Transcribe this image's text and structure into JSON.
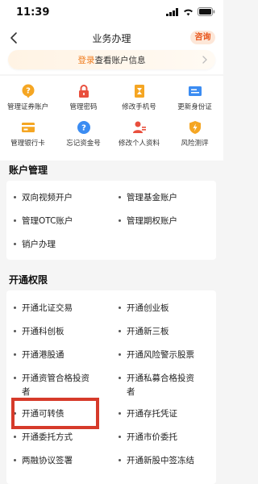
{
  "status_bar": {
    "time": "11:39",
    "signal_icon": "signal-icon",
    "wifi_icon": "wifi-icon",
    "battery_icon": "battery-icon"
  },
  "nav": {
    "title": "业务办理",
    "consult_label": "咨询",
    "back_icon": "chevron-left-icon"
  },
  "login_bar": {
    "link_text": "登录",
    "text": "查看账户信息",
    "arrow_icon": "chevron-right-icon"
  },
  "quick_grid": [
    {
      "label": "管理证券账户",
      "icon": "question-mark-icon",
      "color": "#f5a623"
    },
    {
      "label": "管理密码",
      "icon": "lock-icon",
      "color": "#e94f3d"
    },
    {
      "label": "修改手机号",
      "icon": "hourglass-icon",
      "color": "#f5a623"
    },
    {
      "label": "更新身份证",
      "icon": "id-card-icon",
      "color": "#3b8cf2"
    },
    {
      "label": "管理银行卡",
      "icon": "bank-card-icon",
      "color": "#f5a623"
    },
    {
      "label": "忘记资金号",
      "icon": "question-mark-icon",
      "color": "#3b8cf2"
    },
    {
      "label": "修改个人资料",
      "icon": "person-edit-icon",
      "color": "#e94f3d"
    },
    {
      "label": "风险测评",
      "icon": "shield-bolt-icon",
      "color": "#f5a623"
    }
  ],
  "account_section": {
    "title": "账户管理",
    "items": [
      "双向视频开户",
      "管理基金账户",
      "管理OTC账户",
      "管理期权账户",
      "销户办理"
    ]
  },
  "permission_section": {
    "title": "开通权限",
    "items": [
      "开通北证交易",
      "开通创业板",
      "开通科创板",
      "开通新三板",
      "开通港股通",
      "开通风险警示股票",
      "开通资管合格投资",
      "开通私募合格投资",
      "开通可转债",
      "开通存托凭证",
      "开通委托方式",
      "开通市价委托",
      "两融协议签署",
      "开通新股中签冻结"
    ],
    "wrap": [
      "者",
      "者"
    ]
  }
}
